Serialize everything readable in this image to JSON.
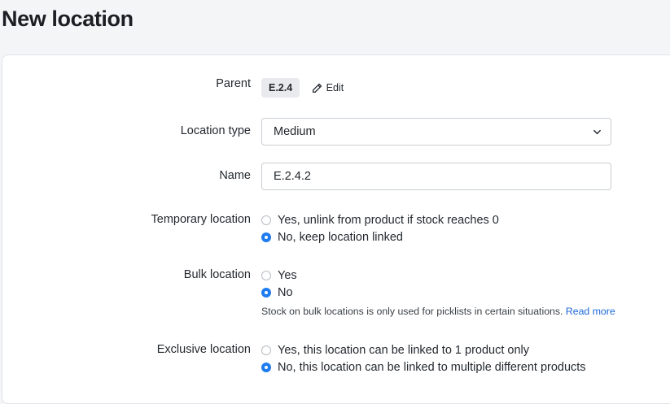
{
  "page": {
    "title": "New location"
  },
  "parent": {
    "label": "Parent",
    "value": "E.2.4",
    "edit_label": "Edit"
  },
  "location_type": {
    "label": "Location type",
    "selected": "Medium"
  },
  "name": {
    "label": "Name",
    "value": "E.2.4.2"
  },
  "temporary": {
    "label": "Temporary location",
    "options": [
      {
        "label": "Yes, unlink from product if stock reaches 0",
        "checked": false
      },
      {
        "label": "No, keep location linked",
        "checked": true
      }
    ]
  },
  "bulk": {
    "label": "Bulk location",
    "options": [
      {
        "label": "Yes",
        "checked": false
      },
      {
        "label": "No",
        "checked": true
      }
    ],
    "help_text": "Stock on bulk locations is only used for picklists in certain situations.",
    "help_link": "Read more"
  },
  "exclusive": {
    "label": "Exclusive location",
    "options": [
      {
        "label": "Yes, this location can be linked to 1 product only",
        "checked": false
      },
      {
        "label": "No, this location can be linked to multiple different products",
        "checked": true
      }
    ]
  },
  "colors": {
    "accent": "#1f7bf0",
    "link": "#1a66d6",
    "background": "#f4f5f7"
  }
}
